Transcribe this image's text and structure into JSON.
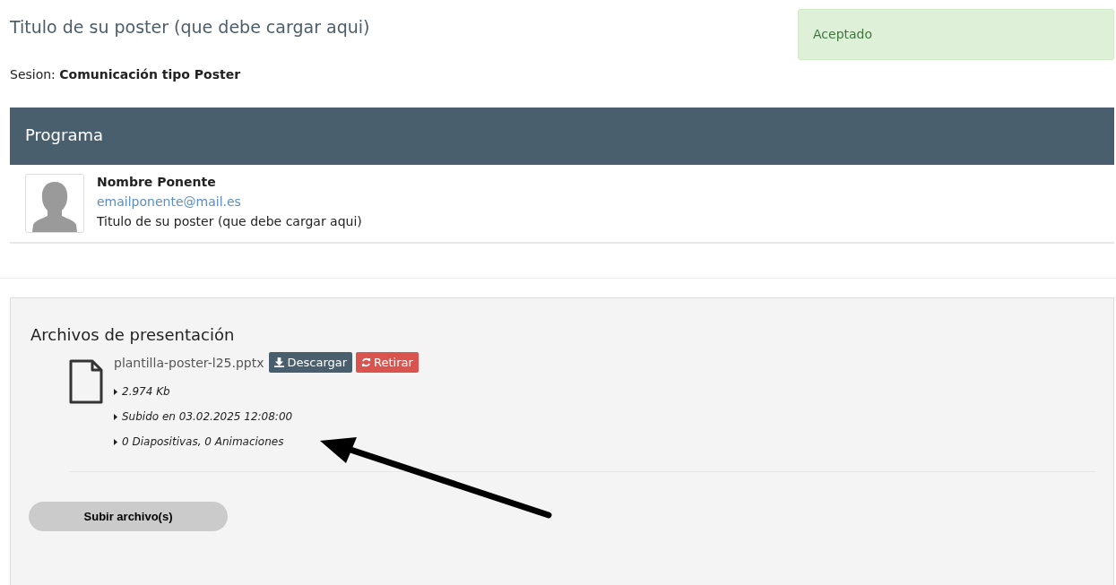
{
  "title": "Titulo de su poster (que debe cargar aqui)",
  "status": {
    "label": "Aceptado",
    "kind": "success"
  },
  "session": {
    "label": "Sesion:",
    "value": "Comunicación tipo Poster"
  },
  "program": {
    "heading": "Programa",
    "speakers": [
      {
        "name": "Nombre Ponente",
        "email": "emailponente@mail.es",
        "talk": "Titulo de su poster (que debe cargar aqui)"
      }
    ]
  },
  "files_panel": {
    "heading": "Archivos de presentación",
    "files": [
      {
        "name": "plantilla-poster-l25.pptx",
        "download": "Descargar",
        "remove": "Retirar",
        "details": [
          "2.974 Kb",
          "Subido en 03.02.2025 12:08:00",
          "0 Diapositivas, 0 Animaciones"
        ]
      }
    ],
    "upload_button": "Subir archivo(s)"
  }
}
